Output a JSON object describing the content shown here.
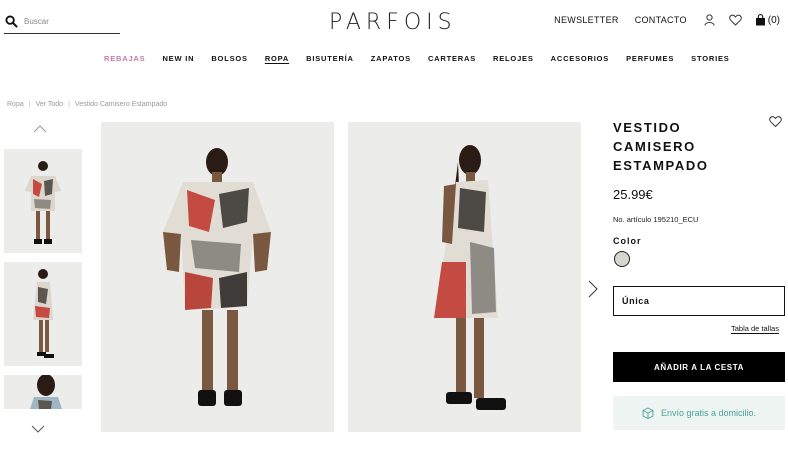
{
  "header": {
    "search_placeholder": "Buscar",
    "logo": "PARFOIS",
    "newsletter": "NEWSLETTER",
    "contact": "CONTACTO",
    "cart_count": "(0)"
  },
  "nav": {
    "items": [
      "REBAJAS",
      "NEW IN",
      "BOLSOS",
      "ROPA",
      "BISUTERÍA",
      "ZAPATOS",
      "CARTERAS",
      "RELOJES",
      "ACCESORIOS",
      "PERFUMES",
      "STORIES"
    ],
    "sale_color": "#c87aa6"
  },
  "breadcrumb": [
    "Ropa",
    "Ver Todo",
    "Vestido Camisero Estampado"
  ],
  "product": {
    "title": "VESTIDO CAMISERO ESTAMPADO",
    "price": "25.99€",
    "reference": "No. artículo 195210_ECU",
    "color_label": "Color",
    "swatch_color": "#d6d6cf",
    "size": "Única",
    "size_guide": "Tabla de tallas",
    "add_to_cart": "AÑADIR A LA CESTA",
    "shipping": "Envío gratis a domicilio.",
    "shipping_color": "#4aa39a"
  },
  "icons": {
    "search": "search-icon",
    "user": "user-icon",
    "wishlist": "heart-icon",
    "cart": "bag-icon",
    "prev": "chevron-up-icon",
    "next": "chevron-down-icon",
    "gallery_next": "chevron-right-icon",
    "box": "box-icon"
  }
}
